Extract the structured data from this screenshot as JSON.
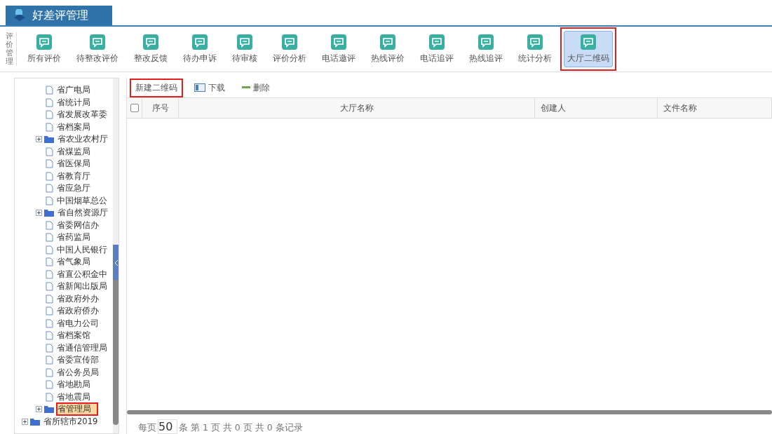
{
  "app_title": "好差评管理",
  "toolbar": {
    "group_label": "评价管理",
    "items": [
      {
        "label": "所有评价",
        "selected": false
      },
      {
        "label": "待整改评价",
        "selected": false
      },
      {
        "label": "整改反馈",
        "selected": false
      },
      {
        "label": "待办申诉",
        "selected": false
      },
      {
        "label": "待审核",
        "selected": false
      },
      {
        "label": "评价分析",
        "selected": false
      },
      {
        "label": "电话邀评",
        "selected": false
      },
      {
        "label": "热线评价",
        "selected": false
      },
      {
        "label": "电话追评",
        "selected": false
      },
      {
        "label": "热线追评",
        "selected": false
      },
      {
        "label": "统计分析",
        "selected": false
      },
      {
        "label": "大厅二维码",
        "selected": true,
        "marked": true
      }
    ]
  },
  "tree": {
    "nodes": [
      {
        "label": "省广电局",
        "kind": "file"
      },
      {
        "label": "省统计局",
        "kind": "file"
      },
      {
        "label": "省发展改革委",
        "kind": "file"
      },
      {
        "label": "省档案局",
        "kind": "file"
      },
      {
        "label": "省农业农村厅",
        "kind": "folder",
        "expanded": false
      },
      {
        "label": "省煤监局",
        "kind": "file"
      },
      {
        "label": "省医保局",
        "kind": "file"
      },
      {
        "label": "省教育厅",
        "kind": "file"
      },
      {
        "label": "省应急厅",
        "kind": "file"
      },
      {
        "label": "中国烟草总公",
        "kind": "file"
      },
      {
        "label": "省自然资源厅",
        "kind": "folder",
        "expanded": false
      },
      {
        "label": "省委网信办",
        "kind": "file"
      },
      {
        "label": "省药监局",
        "kind": "file"
      },
      {
        "label": "中国人民银行",
        "kind": "file"
      },
      {
        "label": "省气象局",
        "kind": "file"
      },
      {
        "label": "省直公积金中",
        "kind": "file"
      },
      {
        "label": "省新闻出版局",
        "kind": "file"
      },
      {
        "label": "省政府外办",
        "kind": "file"
      },
      {
        "label": "省政府侨办",
        "kind": "file"
      },
      {
        "label": "省电力公司",
        "kind": "file"
      },
      {
        "label": "省档案馆",
        "kind": "file"
      },
      {
        "label": "省通信管理局",
        "kind": "file"
      },
      {
        "label": "省委宣传部",
        "kind": "file"
      },
      {
        "label": "省公务员局",
        "kind": "file"
      },
      {
        "label": "省地勘局",
        "kind": "file"
      },
      {
        "label": "省地震局",
        "kind": "file"
      },
      {
        "label": "省管理局",
        "kind": "folder",
        "expanded": false,
        "selected": true,
        "marked": true
      }
    ],
    "outer_nodes": [
      {
        "label": "省所辖市2019",
        "kind": "folder",
        "expanded": false
      }
    ]
  },
  "actions": [
    {
      "label": "新建二维码",
      "kind": "plain",
      "marked": true
    },
    {
      "label": "下载",
      "kind": "download"
    },
    {
      "label": "删除",
      "kind": "delete"
    }
  ],
  "table": {
    "header_checkbox": {
      "checked": false
    },
    "columns": [
      "序号",
      "大厅名称",
      "创建人",
      "文件名称"
    ]
  },
  "pager": {
    "before": "每页",
    "page_size": "50",
    "after": "条 第 1 页 共 0 页 共 0 条记录"
  }
}
